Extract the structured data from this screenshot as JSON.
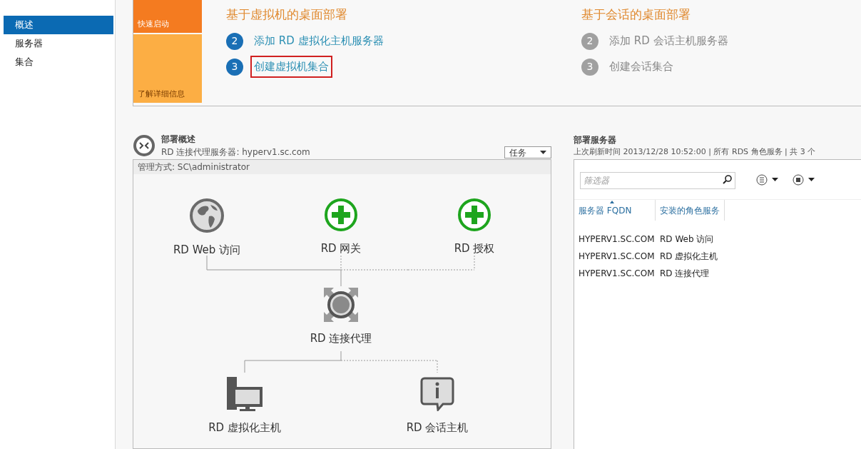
{
  "sidebar": {
    "items": [
      {
        "label": "概述",
        "selected": true
      },
      {
        "label": "服务器",
        "selected": false
      },
      {
        "label": "集合",
        "selected": false
      }
    ]
  },
  "quick_start": {
    "tiles": [
      {
        "label": "快速启动",
        "kind": "dark"
      },
      {
        "label": "了解详细信息",
        "kind": "light"
      }
    ],
    "columns": [
      {
        "title": "基于虚拟机的桌面部署",
        "steps": [
          {
            "number": "2",
            "label": "添加 RD 虚拟化主机服务器",
            "enabled": true,
            "highlighted": false
          },
          {
            "number": "3",
            "label": "创建虚拟机集合",
            "enabled": true,
            "highlighted": true
          }
        ]
      },
      {
        "title": "基于会话的桌面部署",
        "steps": [
          {
            "number": "2",
            "label": "添加 RD 会话主机服务器",
            "enabled": false,
            "highlighted": false
          },
          {
            "number": "3",
            "label": "创建会话集合",
            "enabled": false,
            "highlighted": false
          }
        ]
      }
    ]
  },
  "deployment_overview": {
    "title": "部署概述",
    "subtitle": "RD 连接代理服务器: hyperv1.sc.com",
    "tasks_button": "任务",
    "managed_by": "管理方式: SC\\administrator",
    "top_nodes": [
      {
        "label": "RD Web 访问",
        "kind": "globe",
        "installed": true
      },
      {
        "label": "RD 网关",
        "kind": "add",
        "installed": false
      },
      {
        "label": "RD 授权",
        "kind": "add",
        "installed": false
      }
    ],
    "broker": {
      "label": "RD 连接代理",
      "kind": "broker"
    },
    "bottom_nodes": [
      {
        "label": "RD 虚拟化主机",
        "kind": "computer",
        "installed": true
      },
      {
        "label": "RD 会话主机",
        "kind": "info",
        "installed": false
      }
    ]
  },
  "deployment_servers": {
    "title": "部署服务器",
    "subtitle": "上次刷新时间 2013/12/28 10:52:00 | 所有 RDS 角色服务  | 共 3 个",
    "filter_placeholder": "筛选器",
    "columns": [
      {
        "label": "服务器 FQDN",
        "sorted": true
      },
      {
        "label": "安装的角色服务",
        "sorted": false
      }
    ],
    "rows": [
      [
        "HYPERV1.SC.COM",
        "RD Web 访问"
      ],
      [
        "HYPERV1.SC.COM",
        "RD 虚拟化主机"
      ],
      [
        "HYPERV1.SC.COM",
        "RD 连接代理"
      ]
    ]
  }
}
